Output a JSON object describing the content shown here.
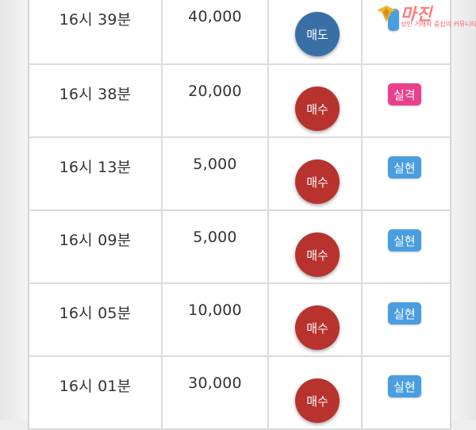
{
  "logo": {
    "text": "마진",
    "sub": "성인 거래자 중심의 커뮤니티"
  },
  "rows": [
    {
      "time": "16시 39분",
      "amount": "40,000",
      "action": "매도",
      "action_type": "sell",
      "status": "",
      "status_type": "real"
    },
    {
      "time": "16시 38분",
      "amount": "20,000",
      "action": "매수",
      "action_type": "buy",
      "status": "실격",
      "status_type": "fail"
    },
    {
      "time": "16시 13분",
      "amount": "5,000",
      "action": "매수",
      "action_type": "buy",
      "status": "실현",
      "status_type": "real"
    },
    {
      "time": "16시 09분",
      "amount": "5,000",
      "action": "매수",
      "action_type": "buy",
      "status": "실현",
      "status_type": "real"
    },
    {
      "time": "16시 05분",
      "amount": "10,000",
      "action": "매수",
      "action_type": "buy",
      "status": "실현",
      "status_type": "real"
    },
    {
      "time": "16시 01분",
      "amount": "30,000",
      "action": "매수",
      "action_type": "buy",
      "status": "실현",
      "status_type": "real"
    }
  ],
  "colors": {
    "buy": "#b8332e",
    "sell": "#3a6fa6",
    "real": "#4a9ee0",
    "fail": "#e8408e"
  }
}
